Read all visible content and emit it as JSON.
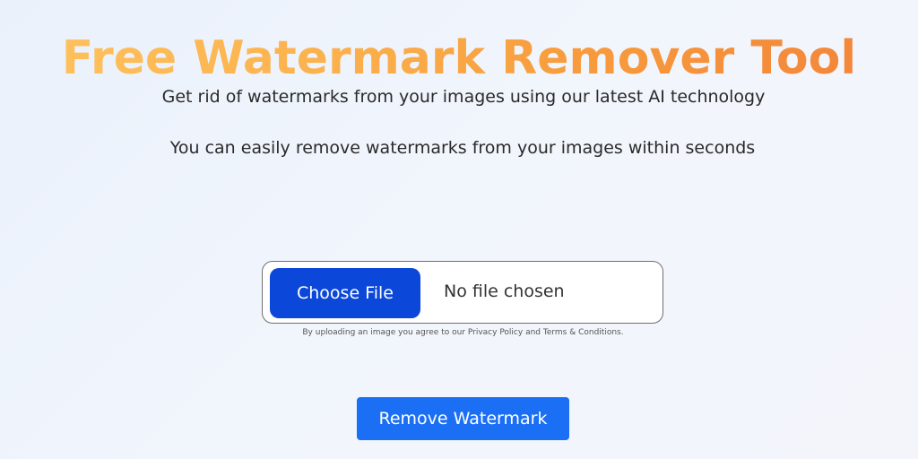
{
  "header": {
    "title": "Free Watermark Remover Tool",
    "subtitle_line1": "Get rid of watermarks from your images using our latest AI technology",
    "subtitle_line2": "You can easily remove watermarks from your images within seconds"
  },
  "upload": {
    "choose_label": "Choose File",
    "status": "No file chosen",
    "disclaimer": "By uploading an image you agree to our Privacy Policy and Terms & Conditions."
  },
  "actions": {
    "remove_label": "Remove Watermark"
  },
  "colors": {
    "title_gradient_start": "#ffc35f",
    "title_gradient_end": "#f2823a",
    "choose_button": "#0b47d9",
    "remove_button": "#1a6ff5"
  }
}
